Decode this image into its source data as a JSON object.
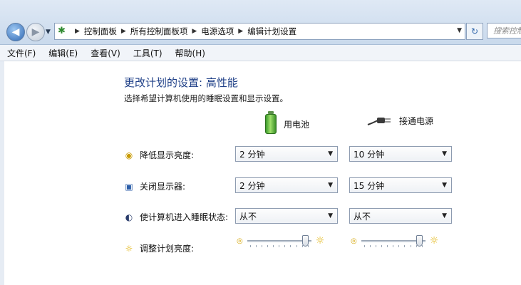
{
  "address_bar": {
    "crumbs": [
      "控制面板",
      "所有控制面板项",
      "电源选项",
      "编辑计划设置"
    ],
    "search_placeholder": "搜索控制"
  },
  "menu": [
    "文件(F)",
    "编辑(E)",
    "查看(V)",
    "工具(T)",
    "帮助(H)"
  ],
  "page": {
    "title": "更改计划的设置: 高性能",
    "subtitle": "选择希望计算机使用的睡眠设置和显示设置。"
  },
  "columns": {
    "battery": "用电池",
    "plugged": "接通电源"
  },
  "settings": [
    {
      "label": "降低显示亮度:",
      "icon": "dim-display-icon",
      "battery": "2 分钟",
      "plugged": "10 分钟"
    },
    {
      "label": "关闭显示器:",
      "icon": "monitor-off-icon",
      "battery": "2 分钟",
      "plugged": "15 分钟"
    },
    {
      "label": "使计算机进入睡眠状态:",
      "icon": "sleep-moon-icon",
      "battery": "从不",
      "plugged": "从不"
    }
  ],
  "brightness": {
    "label": "调整计划亮度:",
    "battery_level": 0.95,
    "plugged_level": 0.95
  }
}
